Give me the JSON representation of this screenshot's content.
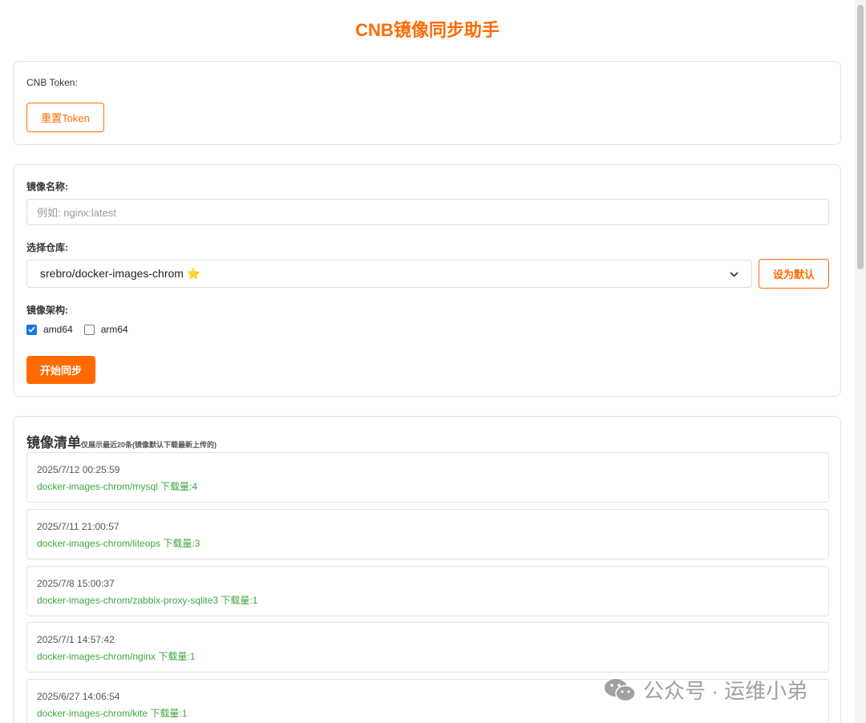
{
  "app": {
    "title": "CNB镜像同步助手"
  },
  "token": {
    "label": "CNB Token:",
    "reset_label": "重置Token"
  },
  "form": {
    "image_name_label": "镜像名称:",
    "image_name_placeholder": "例如: nginx:latest",
    "repo_label": "选择仓库:",
    "repo_selected": "srebro/docker-images-chrom ⭐",
    "set_default_label": "设为默认",
    "arch_label": "镜像架构:",
    "arch_options": [
      {
        "label": "amd64",
        "checked": true
      },
      {
        "label": "arm64",
        "checked": false
      }
    ],
    "start_label": "开始同步"
  },
  "list": {
    "title": "镜像清单",
    "subtitle": "仅展示最近20条(镜像默认下载最新上传的)",
    "items": [
      {
        "time": "2025/7/12 00:25:59",
        "name": "docker-images-chrom/mysql 下载量:4"
      },
      {
        "time": "2025/7/11 21:00:57",
        "name": "docker-images-chrom/liteops 下载量:3"
      },
      {
        "time": "2025/7/8 15:00:37",
        "name": "docker-images-chrom/zabbix-proxy-sqlite3 下载量:1"
      },
      {
        "time": "2025/7/1 14:57:42",
        "name": "docker-images-chrom/nginx 下载量:1"
      },
      {
        "time": "2025/6/27 14:06:54",
        "name": "docker-images-chrom/kite 下载量:1"
      }
    ]
  },
  "watermark": {
    "text": "公众号 · 运维小弟"
  },
  "colors": {
    "accent": "#ff6a00",
    "success": "#3fa640",
    "checkbox": "#1a73e8"
  }
}
